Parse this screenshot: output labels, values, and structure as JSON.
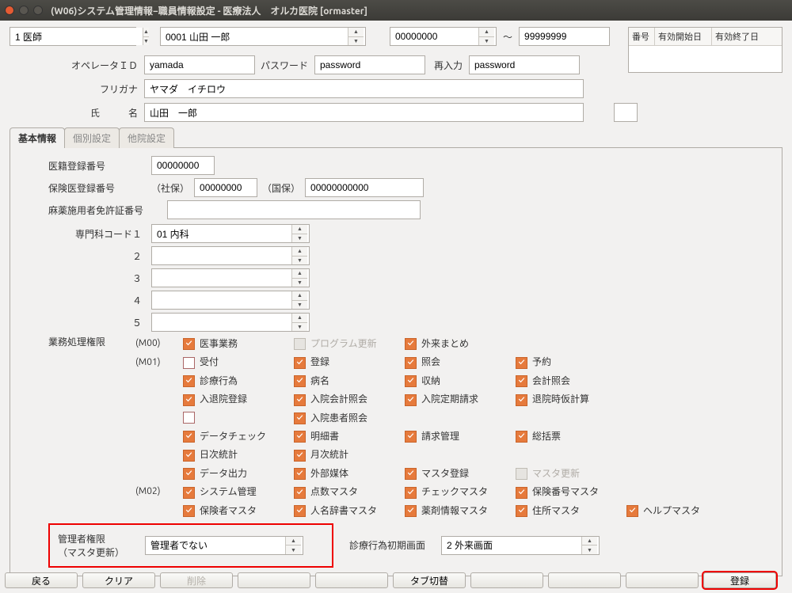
{
  "window": {
    "title": "(W06)システム管理情報−職員情報設定 - 医療法人　オルカ医院  [ormaster]"
  },
  "top": {
    "role": "1 医師",
    "staff": "0001 山田 一郎",
    "from": "00000000",
    "to": "99999999",
    "tilde": "～"
  },
  "list_h": {
    "c1": "番号",
    "c2": "有効開始日",
    "c3": "有効終了日"
  },
  "fields": {
    "opid_l": "オペレータＩＤ",
    "opid": "yamada",
    "pw_l": "パスワード",
    "pw": "password",
    "pw2_l": "再入力",
    "pw2": "password",
    "kana_l": "フリガナ",
    "kana": "ヤマダ　イチロウ",
    "name_l": "氏　　　名",
    "name": "山田　一郎"
  },
  "tabs": {
    "t1": "基本情報",
    "t2": "個別設定",
    "t3": "他院設定"
  },
  "basic": {
    "iseki_l": "医籍登録番号",
    "iseki": "00000000",
    "hoken_l": "保険医登録番号",
    "sha": "（社保）",
    "sha_v": "00000000",
    "koku": "（国保）",
    "koku_v": "00000000000",
    "mayaku_l": "麻薬施用者免許証番号",
    "mayaku": "",
    "dept_l1": "専門科コード１",
    "dept_l2": "２",
    "dept_l3": "３",
    "dept_l4": "４",
    "dept_l5": "５",
    "dept1": "01 内科",
    "dept2": "",
    "dept3": "",
    "dept4": "",
    "dept5": ""
  },
  "perm_l": "業務処理権限",
  "perm": {
    "m00": "(M00)",
    "m01": "(M01)",
    "m02": "(M02)",
    "p01": "医事業務",
    "p02": "プログラム更新",
    "p03": "外来まとめ",
    "p04": "受付",
    "p05": "登録",
    "p06": "照会",
    "p07": "予約",
    "p08": "診療行為",
    "p09": "病名",
    "p10": "収納",
    "p11": "会計照会",
    "p12": "入退院登録",
    "p13": "入院会計照会",
    "p14": "入院定期請求",
    "p15": "退院時仮計算",
    "p16": "入院患者照会",
    "p17": "データチェック",
    "p18": "明細書",
    "p19": "請求管理",
    "p20": "総括票",
    "p21": "日次統計",
    "p22": "月次統計",
    "p23": "データ出力",
    "p24": "外部媒体",
    "p25": "マスタ登録",
    "p26": "マスタ更新",
    "p27": "システム管理",
    "p28": "点数マスタ",
    "p29": "チェックマスタ",
    "p30": "保険番号マスタ",
    "p31": "保険者マスタ",
    "p32": "人名辞書マスタ",
    "p33": "薬剤情報マスタ",
    "p34": "住所マスタ",
    "p35": "ヘルプマスタ"
  },
  "admin": {
    "l1": "管理者権限",
    "l2": "（マスタ更新）",
    "val": "管理者でない",
    "init_l": "診療行為初期画面",
    "init_v": "2 外来画面"
  },
  "buttons": {
    "b1": "戻る",
    "b2": "クリア",
    "b3": "削除",
    "b4": "タブ切替",
    "b5": "登録"
  }
}
